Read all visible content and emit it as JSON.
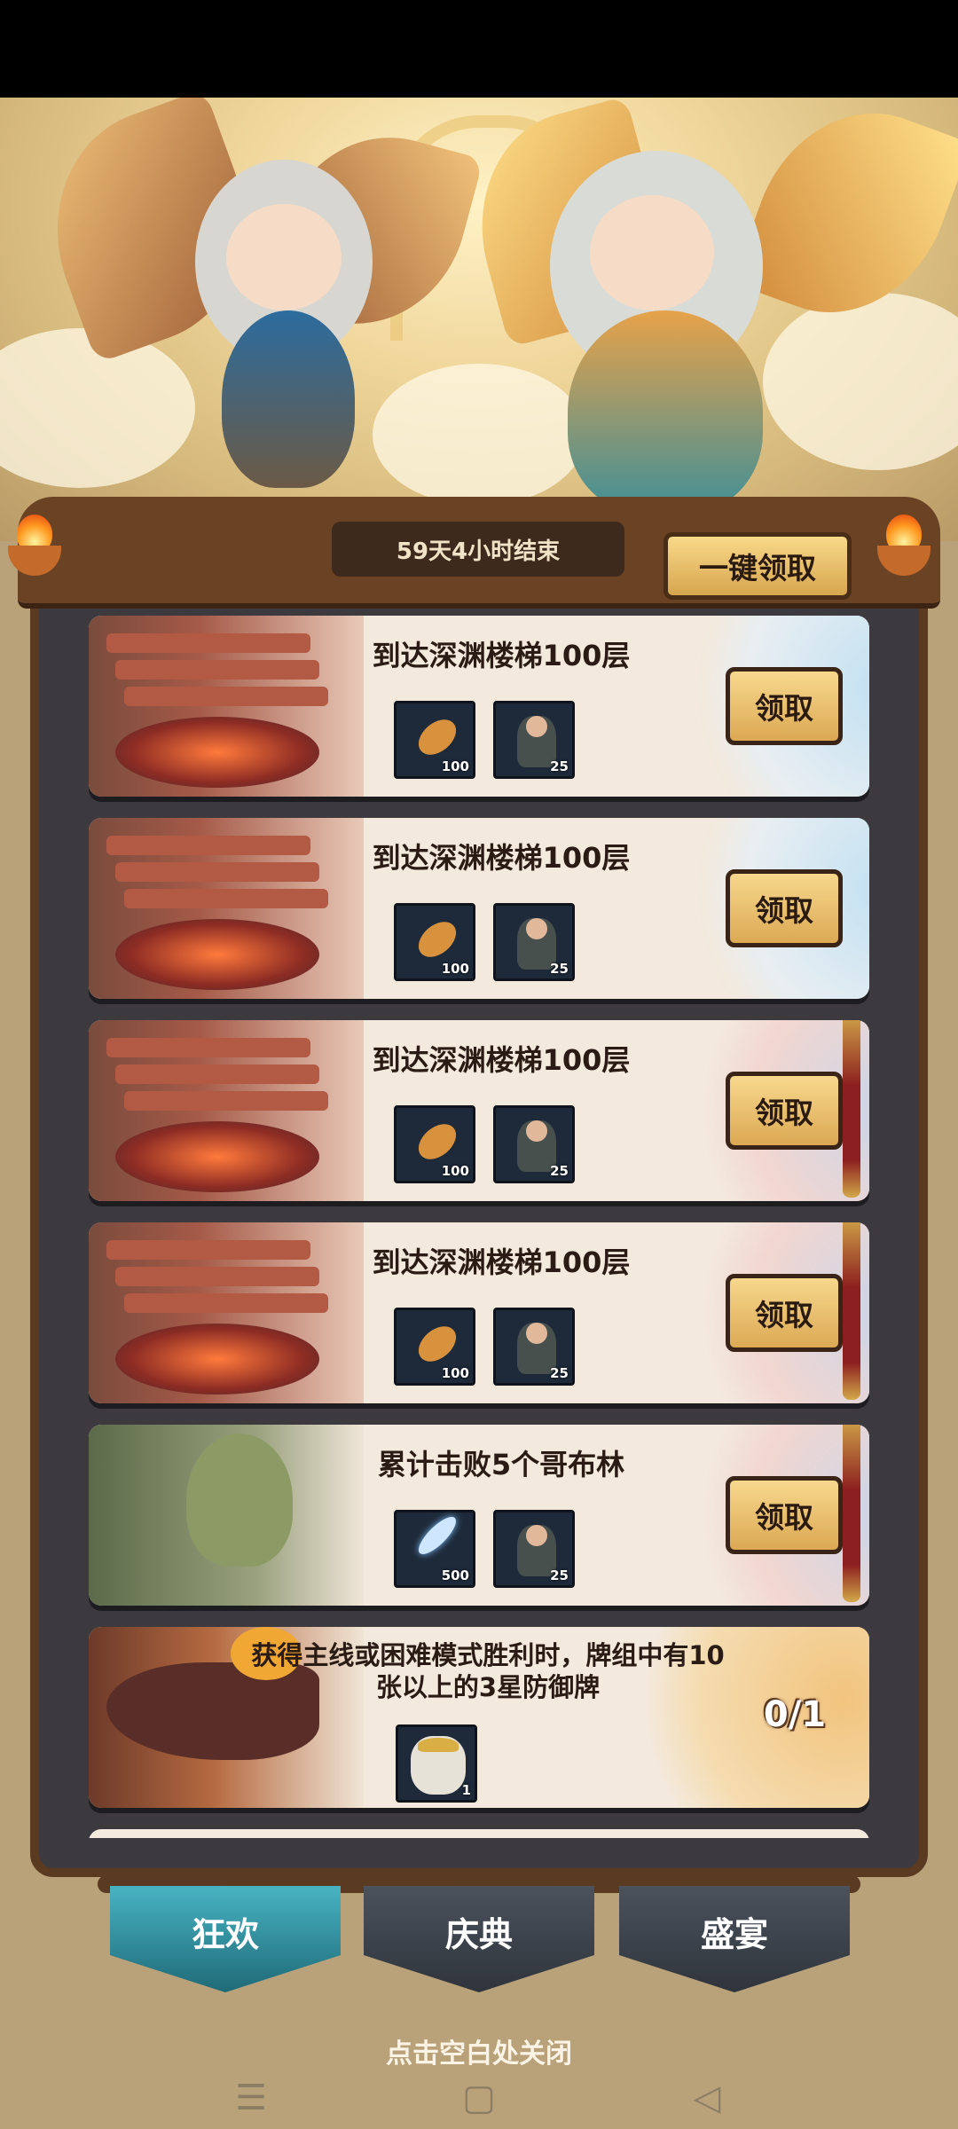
{
  "timer": "59天4小时结束",
  "claim_all_label": "一键领取",
  "tasks": [
    {
      "title": "到达深渊楼梯100层",
      "rewards": [
        {
          "icon": "bread-icon",
          "qty": "100"
        },
        {
          "icon": "hero-figure-icon",
          "qty": "25"
        }
      ],
      "action": "领取"
    },
    {
      "title": "到达深渊楼梯100层",
      "rewards": [
        {
          "icon": "bread-icon",
          "qty": "100"
        },
        {
          "icon": "hero-figure-icon",
          "qty": "25"
        }
      ],
      "action": "领取"
    },
    {
      "title": "到达深渊楼梯100层",
      "rewards": [
        {
          "icon": "bread-icon",
          "qty": "100"
        },
        {
          "icon": "hero-figure-icon",
          "qty": "25"
        }
      ],
      "action": "领取"
    },
    {
      "title": "到达深渊楼梯100层",
      "rewards": [
        {
          "icon": "bread-icon",
          "qty": "100"
        },
        {
          "icon": "hero-figure-icon",
          "qty": "25"
        }
      ],
      "action": "领取"
    },
    {
      "title": "累计击败5个哥布林",
      "rewards": [
        {
          "icon": "feather-icon",
          "qty": "500"
        },
        {
          "icon": "hero-figure-icon",
          "qty": "25"
        }
      ],
      "action": "领取"
    },
    {
      "title": "获得主线或困难模式胜利时，牌组中有10张以上的3星防御牌",
      "rewards": [
        {
          "icon": "hero-portrait-icon",
          "qty": "1"
        }
      ],
      "progress": "0/1"
    }
  ],
  "tabs": [
    {
      "label": "狂欢",
      "active": true
    },
    {
      "label": "庆典",
      "active": false
    },
    {
      "label": "盛宴",
      "active": false
    }
  ],
  "close_hint": "点击空白处关闭",
  "nav": {
    "menu": "☰",
    "home": "▢",
    "back": "◁"
  },
  "colors": {
    "tab_active": "#2f8f9e",
    "button_gold": "#e8bd6a",
    "frame_wood": "#6a4325"
  }
}
